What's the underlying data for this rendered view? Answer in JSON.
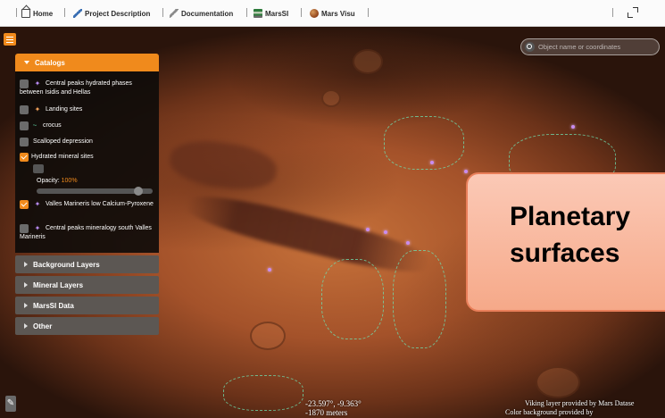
{
  "nav": {
    "items": [
      {
        "label": "Home",
        "icon": "home-icon"
      },
      {
        "label": "Project Description",
        "icon": "pencil-icon"
      },
      {
        "label": "Documentation",
        "icon": "document-icon"
      },
      {
        "label": "MarsSI",
        "icon": "chart-icon"
      },
      {
        "label": "Mars Visu",
        "icon": "mars-globe-icon"
      }
    ],
    "fullscreen_icon": "expand-icon"
  },
  "search": {
    "placeholder": "Object name or coordinates"
  },
  "panel": {
    "catalogs_label": "Catalogs",
    "layers": [
      {
        "label": "Central peaks hydrated phases between Isidis and Hellas",
        "checked": false,
        "symbol": "✦"
      },
      {
        "label": "Landing sites",
        "checked": false,
        "symbol": "✦"
      },
      {
        "label": "crocus",
        "checked": false,
        "symbol": "~"
      },
      {
        "label": "Scalloped depression",
        "checked": false,
        "symbol": ""
      },
      {
        "label": "Hydrated mineral sites",
        "checked": true,
        "symbol": ""
      },
      {
        "label": "Valles Marineris low Calcium-Pyroxene",
        "checked": true,
        "symbol": "✦"
      },
      {
        "label": "Central peaks mineralogy south Valles Marineris",
        "checked": false,
        "symbol": "✦"
      }
    ],
    "opacity_label": "Opacity:",
    "opacity_value": "100%",
    "sections": [
      "Background Layers",
      "Mineral Layers",
      "MarsSI Data",
      "Other"
    ]
  },
  "overlay": {
    "title": "Planetary\nsurfaces"
  },
  "status": {
    "coordinates": "-23.597°, -9.363°",
    "altitude": "-1870 meters",
    "credit_line1": "Viking layer provided by Mars Datase",
    "credit_line2": "Color background provided by"
  },
  "colors": {
    "accent": "#f08a1c",
    "panel_bg": "#0f0c0a",
    "overlay_bg": "#f6a989"
  }
}
